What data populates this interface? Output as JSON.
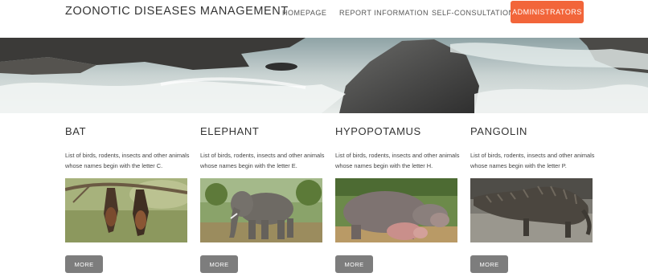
{
  "header": {
    "site_title": "ZOONOTIC DISEASES MANAGEMENT",
    "nav": {
      "homepage": "HOMEPAGE",
      "report": "REPORT INFORMATION",
      "self": "SELF-CONSULTATION",
      "admin": "ADMINISTRATORS"
    },
    "accent_color": "#f2653a"
  },
  "cards": [
    {
      "title": "BAT",
      "desc": "List of birds, rodents, insects and other animals whose names begin with the letter C.",
      "button": "MORE",
      "image": "bats-image"
    },
    {
      "title": "ELEPHANT",
      "desc": "List of birds, rodents, insects and other animals whose names begin with the letter E.",
      "button": "MORE",
      "image": "elephant-image"
    },
    {
      "title": "HYPOPOTAMUS",
      "desc": "List of birds, rodents, insects and other animals whose names begin with the letter H.",
      "button": "MORE",
      "image": "hippopotamus-image"
    },
    {
      "title": "PANGOLIN",
      "desc": "List of birds, rodents, insects and other animals whose names begin with the letter P.",
      "button": "MORE",
      "image": "pangolin-image"
    }
  ]
}
